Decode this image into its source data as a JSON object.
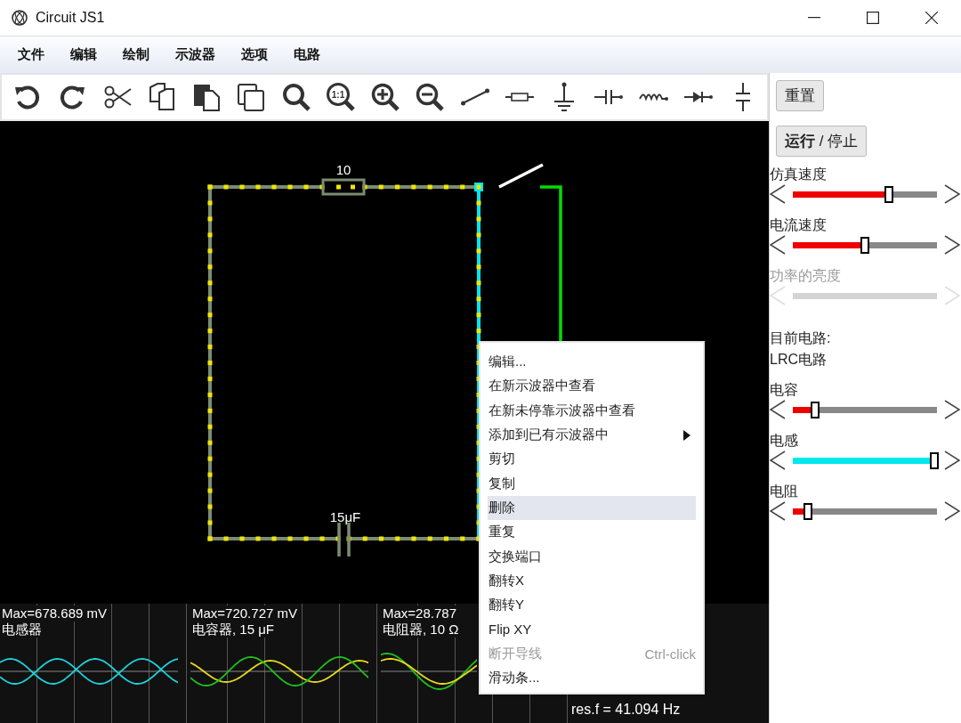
{
  "window": {
    "title": "Circuit JS1"
  },
  "menu": [
    {
      "label": "文件"
    },
    {
      "label": "编辑"
    },
    {
      "label": "绘制"
    },
    {
      "label": "示波器"
    },
    {
      "label": "选项"
    },
    {
      "label": "电路"
    }
  ],
  "toolbar": [
    {
      "kind": "undo"
    },
    {
      "kind": "redo"
    },
    {
      "kind": "cut"
    },
    {
      "kind": "copy"
    },
    {
      "kind": "paste"
    },
    {
      "kind": "duplicate"
    },
    {
      "kind": "search"
    },
    {
      "kind": "zoom-actual",
      "label": "1:1"
    },
    {
      "kind": "zoom-in"
    },
    {
      "kind": "zoom-out"
    },
    {
      "kind": "wire"
    },
    {
      "kind": "resistor"
    },
    {
      "kind": "ground"
    },
    {
      "kind": "capacitor"
    },
    {
      "kind": "inductor"
    },
    {
      "kind": "diode"
    },
    {
      "kind": "plates"
    }
  ],
  "circuit": {
    "resistor_label": "10",
    "capacitor_label": "15μF",
    "switch_closed": false
  },
  "scopes": [
    {
      "max": "Max=678.689 mV",
      "name": "电感器"
    },
    {
      "max": "Max=720.727 mV",
      "name": "电容器, 15 μF"
    },
    {
      "max": "Max=28.787",
      "name": "电阻器, 10 Ω"
    }
  ],
  "scope_info": "res.f = 41.094 Hz",
  "context_menu": [
    {
      "label": "编辑...",
      "selected": false,
      "disabled": false
    },
    {
      "label": "在新示波器中查看",
      "selected": false,
      "disabled": false
    },
    {
      "label": "在新未停靠示波器中查看",
      "selected": false,
      "disabled": false
    },
    {
      "label": "添加到已有示波器中",
      "submenu": true,
      "selected": false,
      "disabled": false
    },
    {
      "label": "剪切",
      "selected": false,
      "disabled": false
    },
    {
      "label": "复制",
      "selected": false,
      "disabled": false
    },
    {
      "label": "删除",
      "selected": true,
      "disabled": false
    },
    {
      "label": "重复",
      "selected": false,
      "disabled": false
    },
    {
      "label": "交换端口",
      "selected": false,
      "disabled": false
    },
    {
      "label": "翻转X",
      "selected": false,
      "disabled": false
    },
    {
      "label": "翻转Y",
      "selected": false,
      "disabled": false
    },
    {
      "label": "Flip XY",
      "selected": false,
      "disabled": false
    },
    {
      "label": "断开导线",
      "shortcut": "Ctrl-click",
      "selected": false,
      "disabled": true
    },
    {
      "label": "滑动条...",
      "selected": false,
      "disabled": false
    }
  ],
  "panel": {
    "reset": "重置",
    "run_stop": "**运行** / 停止",
    "circuit_caption": "目前电路:",
    "circuit_name": "LRC电路"
  },
  "sliders_top": [
    {
      "label": "仿真速度",
      "level": 0.67,
      "color": "#ee0000",
      "disabled": false
    },
    {
      "label": "电流速度",
      "level": 0.5,
      "color": "#ee0000",
      "disabled": false
    },
    {
      "label": "功率的亮度",
      "disabled": true
    }
  ],
  "sliders_bottom": [
    {
      "label": "电容",
      "level": 0.14,
      "color": "#ee0000",
      "disabled": false
    },
    {
      "label": "电感",
      "level": 1.0,
      "color": "#00e8ee",
      "disabled": false
    },
    {
      "label": "电阻",
      "level": 0.09,
      "color": "#ee0000",
      "disabled": false
    }
  ]
}
